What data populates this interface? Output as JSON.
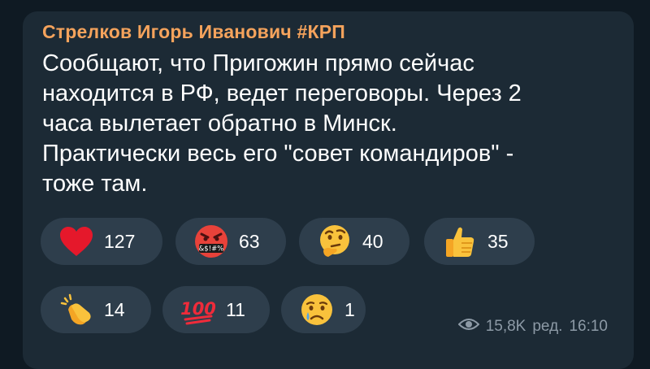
{
  "message": {
    "author": "Стрелков Игорь Иванович #КРП",
    "text": "Сообщают, что Пригожин прямо сейчас\nнаходится в РФ, ведет переговоры. Через 2\nчаса вылетает обратно в Минск.\nПрактически весь его \"совет командиров\" -\nтоже там.",
    "views": "15,8K",
    "edited_label": "ред.",
    "time": "16:10"
  },
  "reactions": [
    {
      "icon": "red-heart-icon",
      "count": "127"
    },
    {
      "icon": "cursing-face-icon",
      "count": "63",
      "face_text": "&$!#%"
    },
    {
      "icon": "thinking-face-icon",
      "count": "40"
    },
    {
      "icon": "thumbs-up-icon",
      "count": "35"
    },
    {
      "icon": "clapping-hands-icon",
      "count": "14"
    },
    {
      "icon": "hundred-points-icon",
      "count": "11",
      "face_text": "100"
    },
    {
      "icon": "crying-face-icon",
      "count": "1"
    }
  ],
  "colors": {
    "author": "#f5a35c",
    "bubble": "#1c2a35",
    "reaction_pill": "#2e3e4c",
    "meta": "#8d9aa6"
  }
}
